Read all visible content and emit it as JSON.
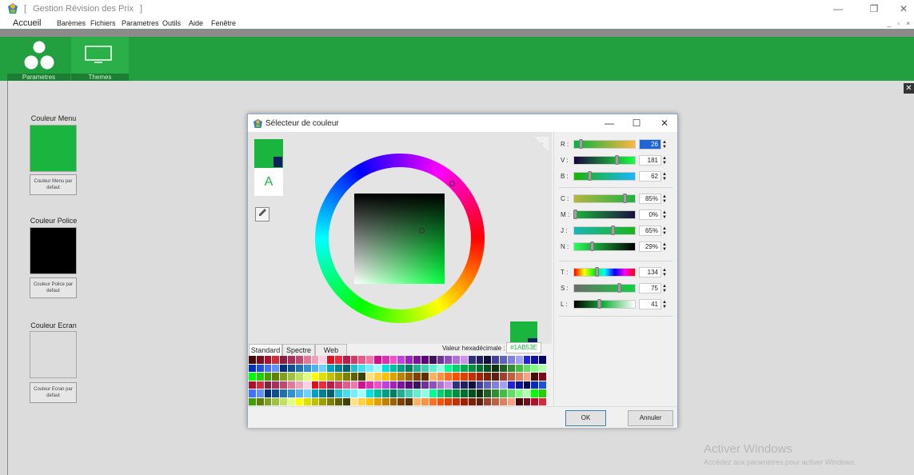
{
  "window": {
    "title": "Gestion Révision des Prix",
    "title_bracket_open": "[",
    "title_bracket_close": "]",
    "minimize": "—",
    "restore": "❐",
    "close": "✕"
  },
  "menubar": {
    "items": [
      "Accueil",
      "Barèmes",
      "Fichiers",
      "Parametres",
      "Outils",
      "Aide",
      "Fenêtre"
    ],
    "mdi_controls": "_ ▫ ×"
  },
  "ribbon": {
    "buttons": [
      {
        "label": "Parametres",
        "icon": "circles-icon"
      },
      {
        "label": "Themes",
        "icon": "monitor-icon"
      }
    ],
    "color": "#22a040"
  },
  "panel_close": "✕",
  "sections": [
    {
      "label": "Couleur Menu",
      "swatch": "#1ab53e",
      "button": "Couleur Menu par defaut"
    },
    {
      "label": "Couleur Police",
      "swatch": "#000000",
      "button": "Couleur Police par defaut"
    },
    {
      "label": "Couleur Ecran",
      "swatch": "#dcdcdc",
      "button": "Couleur Ecran par defaut"
    }
  ],
  "watermark": {
    "line1": "Activer Windows",
    "line2": "Accédez aux paramètres pour activer Windows."
  },
  "dialog": {
    "title": "Sélecteur de couleur",
    "controls": {
      "minimize": "—",
      "maximize": "☐",
      "close": "✕"
    },
    "current_color": "#1ab53e",
    "secondary_color": "#0e2060",
    "preview_letter": "A",
    "collapse_icon": "«",
    "tabs": [
      "Standard",
      "Spectre",
      "Web"
    ],
    "active_tab": "Standard",
    "hex_label": "Valeur hexadécimale :",
    "hex_value": "#1AB53E",
    "sliders": {
      "rgb": [
        {
          "label": "R :",
          "value": "26",
          "position": 0.1,
          "grad": "linear-gradient(to right,#00b53e,#ffb53e)"
        },
        {
          "label": "V :",
          "value": "181",
          "position": 0.71,
          "grad": "linear-gradient(to right,#1a003e,#1aff3e)"
        },
        {
          "label": "B :",
          "value": "62",
          "position": 0.24,
          "grad": "linear-gradient(to right,#1ab500,#1ab5ff)"
        }
      ],
      "cmjn": [
        {
          "label": "C :",
          "value": "85%",
          "position": 0.85,
          "grad": "linear-gradient(to right,#b5b53e,#1ab53e)"
        },
        {
          "label": "M :",
          "value": "0%",
          "position": 0.0,
          "grad": "linear-gradient(to right,#1ab53e,#1a0f3e)"
        },
        {
          "label": "J :",
          "value": "65%",
          "position": 0.65,
          "grad": "linear-gradient(to right,#1ab5b5,#1ab51a)"
        },
        {
          "label": "N :",
          "value": "29%",
          "position": 0.29,
          "grad": "linear-gradient(to right,#2aff5a,#000)"
        }
      ],
      "tsl": [
        {
          "label": "T :",
          "value": "134",
          "position": 0.37,
          "grad": "linear-gradient(to right,#f00,#ff0,#0f0,#0ff,#00f,#f0f,#f00)"
        },
        {
          "label": "S :",
          "value": "75",
          "position": 0.75,
          "grad": "linear-gradient(to right,#6a6a6a,#12d23e)"
        },
        {
          "label": "L :",
          "value": "41",
          "position": 0.41,
          "grad": "linear-gradient(to right,#000,#1ab53e,#fff)"
        }
      ]
    },
    "ok_label": "OK",
    "cancel_label": "Annuler",
    "palette_colors": [
      "#4b0a0a",
      "#7a0a1e",
      "#b0102a",
      "#d42a3a",
      "#8a2040",
      "#a83058",
      "#c04870",
      "#e07898",
      "#f0a0b8",
      "#ffd0e0",
      "#e0101e",
      "#f02838",
      "#c01848",
      "#d83868",
      "#e85888",
      "#f078a8",
      "#d01090",
      "#e030b0",
      "#f050c8",
      "#c040e0",
      "#a020c0",
      "#8010a0",
      "#600080",
      "#401060",
      "#7030a0",
      "#9050c0",
      "#b070d8",
      "#d090f0",
      "#303080",
      "#202060",
      "#101040",
      "#4040a0",
      "#6060c0",
      "#8080e0",
      "#a0a0ff",
      "#2020e0",
      "#1010a0",
      "#000060",
      "#0030c0",
      "#2050e0",
      "#4070ff",
      "#6090ff",
      "#003080",
      "#105090",
      "#2070b0",
      "#3090d0",
      "#50b0f0",
      "#70d0ff",
      "#00a0c0",
      "#008090",
      "#006070",
      "#20c0d0",
      "#40e0f0",
      "#70f0ff",
      "#a0ffff",
      "#00e0e0",
      "#00c0a0",
      "#00a080",
      "#008060",
      "#20b090",
      "#40d0b0",
      "#60f0d0",
      "#90ffe0",
      "#00ff90",
      "#00d070",
      "#00b050",
      "#009040",
      "#007030",
      "#005020",
      "#103010",
      "#206020",
      "#309030",
      "#40c040",
      "#60e060",
      "#80ff80",
      "#b0ffb0",
      "#00ff00",
      "#20d000",
      "#40a000",
      "#608000",
      "#80a020",
      "#a0c040",
      "#c0e060",
      "#e0ff80",
      "#ffff00",
      "#e0e000",
      "#c0c000",
      "#a0a000",
      "#808000",
      "#606000",
      "#404000",
      "#ffe080",
      "#ffd040",
      "#ffc000",
      "#e0a000",
      "#c08000",
      "#a06000",
      "#804000",
      "#603000",
      "#ffb060",
      "#ff9040",
      "#ff7020",
      "#ff5000",
      "#e04000",
      "#c03000",
      "#a02000",
      "#802000",
      "#602010",
      "#a04030",
      "#c06040",
      "#e08060",
      "#ffa080"
    ]
  }
}
